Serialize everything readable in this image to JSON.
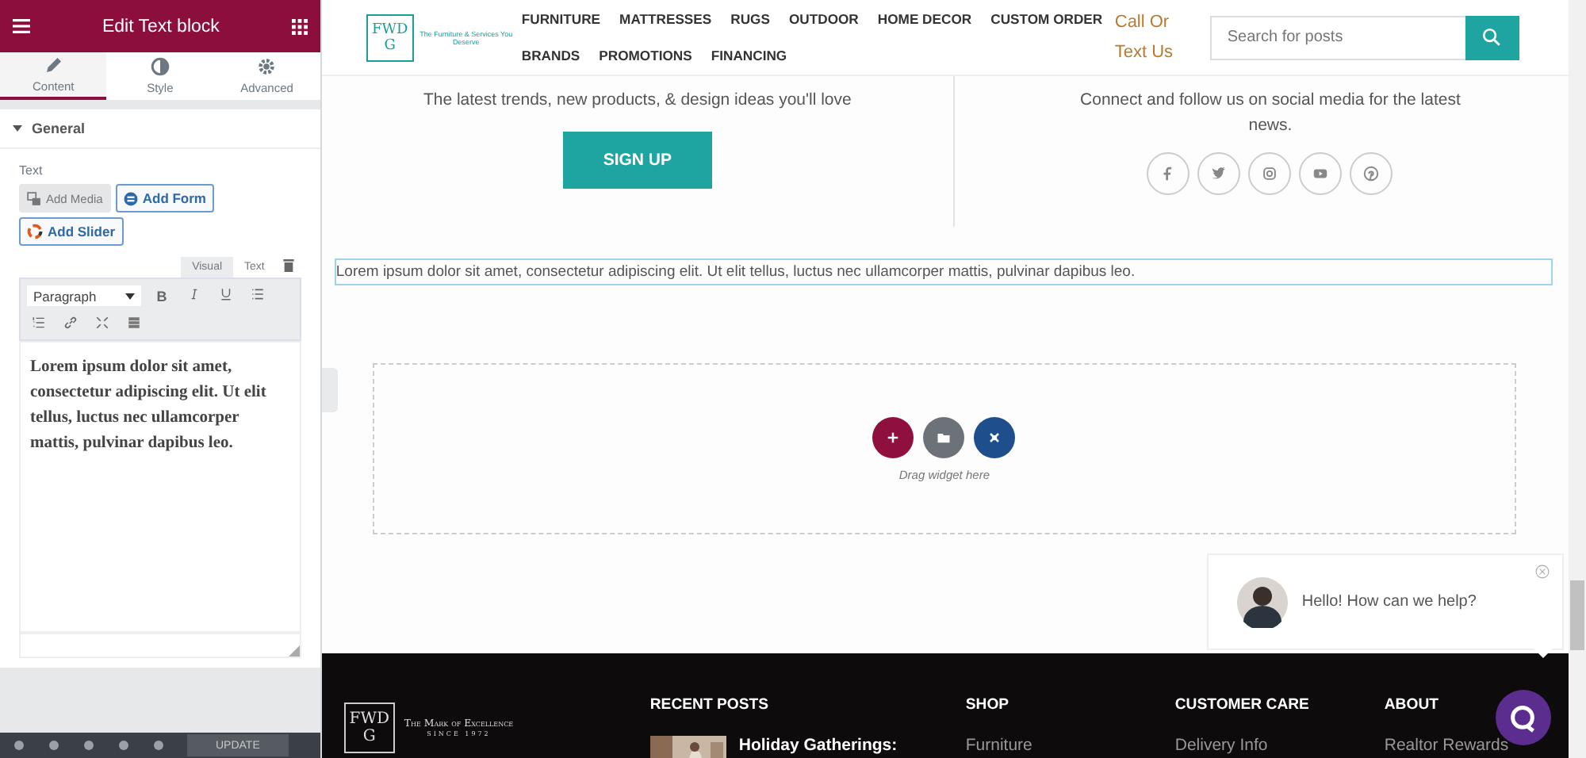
{
  "editor": {
    "title": "Edit Text block",
    "tabs": [
      {
        "label": "Content",
        "selected": true
      },
      {
        "label": "Style",
        "selected": false
      },
      {
        "label": "Advanced",
        "selected": false
      }
    ],
    "section": {
      "title": "General",
      "expanded": true
    },
    "field_label": "Text",
    "media_buttons": [
      {
        "label": "Add Media",
        "kind": "plain"
      },
      {
        "label": "Add Form",
        "kind": "form"
      },
      {
        "label": "Add Slider",
        "kind": "slider"
      }
    ],
    "mode_tabs": [
      {
        "label": "Visual",
        "selected": true
      },
      {
        "label": "Text",
        "selected": false
      }
    ],
    "format_select": "Paragraph",
    "bold_button": "B",
    "content": "Lorem ipsum dolor sit amet, consectetur adipiscing elit. Ut elit tellus, luctus nec ullamcorper mattis, pulvinar dapibus leo.",
    "update_button": "UPDATE"
  },
  "site": {
    "logo": {
      "letters": "FWDG",
      "tagline": "The Furniture & Services You Deserve"
    },
    "nav": [
      [
        "FURNITURE",
        "MATTRESSES",
        "RUGS",
        "OUTDOOR",
        "HOME DECOR",
        "CUSTOM ORDER"
      ],
      [
        "BRANDS",
        "PROMOTIONS",
        "FINANCING"
      ]
    ],
    "call_link": "Call Or Text Us",
    "search": {
      "placeholder": "Search for posts"
    },
    "newsletter": {
      "text": "The latest trends, new products, & design ideas you'll love",
      "button": "SIGN UP"
    },
    "social": {
      "text": "Connect and follow us on social media for the latest news."
    },
    "text_block": "Lorem ipsum dolor sit amet, consectetur adipiscing elit. Ut elit tellus, luctus nec ullamcorper mattis, pulvinar dapibus leo.",
    "drop_zone": "Drag widget here",
    "chat": {
      "message": "Hello! How can we help?"
    },
    "footer": {
      "logo": {
        "letters": "FWDG",
        "motto": "The Mark of Excellence",
        "since": "SINCE 1972"
      },
      "columns": [
        {
          "title": "RECENT POSTS",
          "item": "Holiday Gatherings:",
          "kind": "post"
        },
        {
          "title": "SHOP",
          "item": "Furniture",
          "kind": "link"
        },
        {
          "title": "CUSTOMER CARE",
          "item": "Delivery Info",
          "kind": "link"
        },
        {
          "title": "ABOUT",
          "item": "Realtor Rewards",
          "kind": "link"
        }
      ]
    }
  }
}
